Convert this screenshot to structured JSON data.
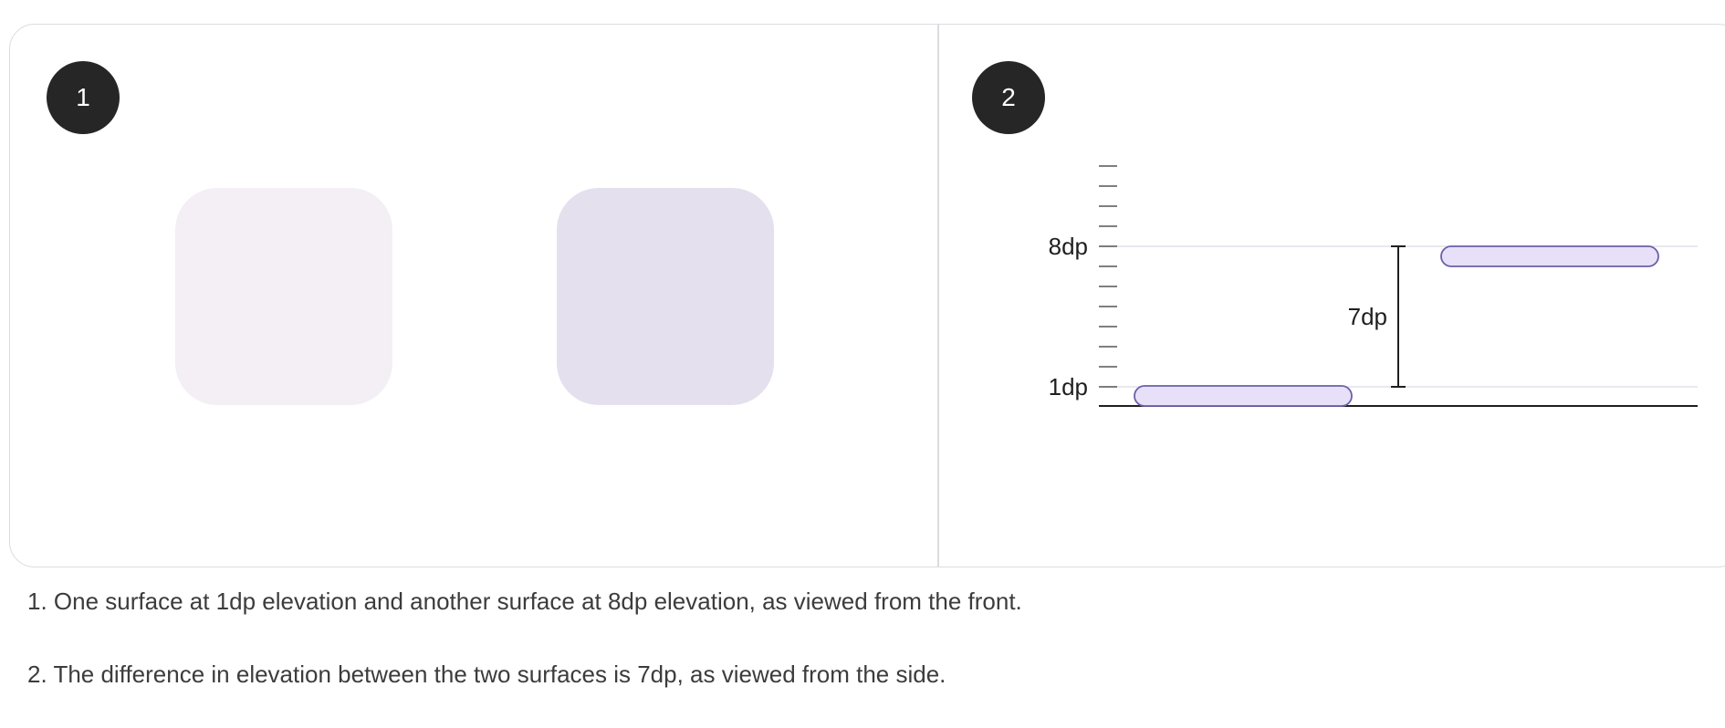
{
  "panels": [
    {
      "badge": "1"
    },
    {
      "badge": "2"
    }
  ],
  "front_view": {
    "surfaces": [
      {
        "elevation": "1dp",
        "color": "#f3eff5"
      },
      {
        "elevation": "8dp",
        "color": "#e4e0ee"
      }
    ]
  },
  "side_view": {
    "label_high": "8dp",
    "label_low": "1dp",
    "difference_label": "7dp",
    "surface_fill": "#e8e0f8",
    "surface_stroke": "#6b5fa8",
    "low_surface_dp": 1,
    "high_surface_dp": 8,
    "scale_max_dp": 12
  },
  "captions": [
    "1. One surface at 1dp elevation and another surface at 8dp elevation, as viewed from the front.",
    "2. The difference in elevation between the two surfaces is 7dp, as viewed from the side."
  ]
}
